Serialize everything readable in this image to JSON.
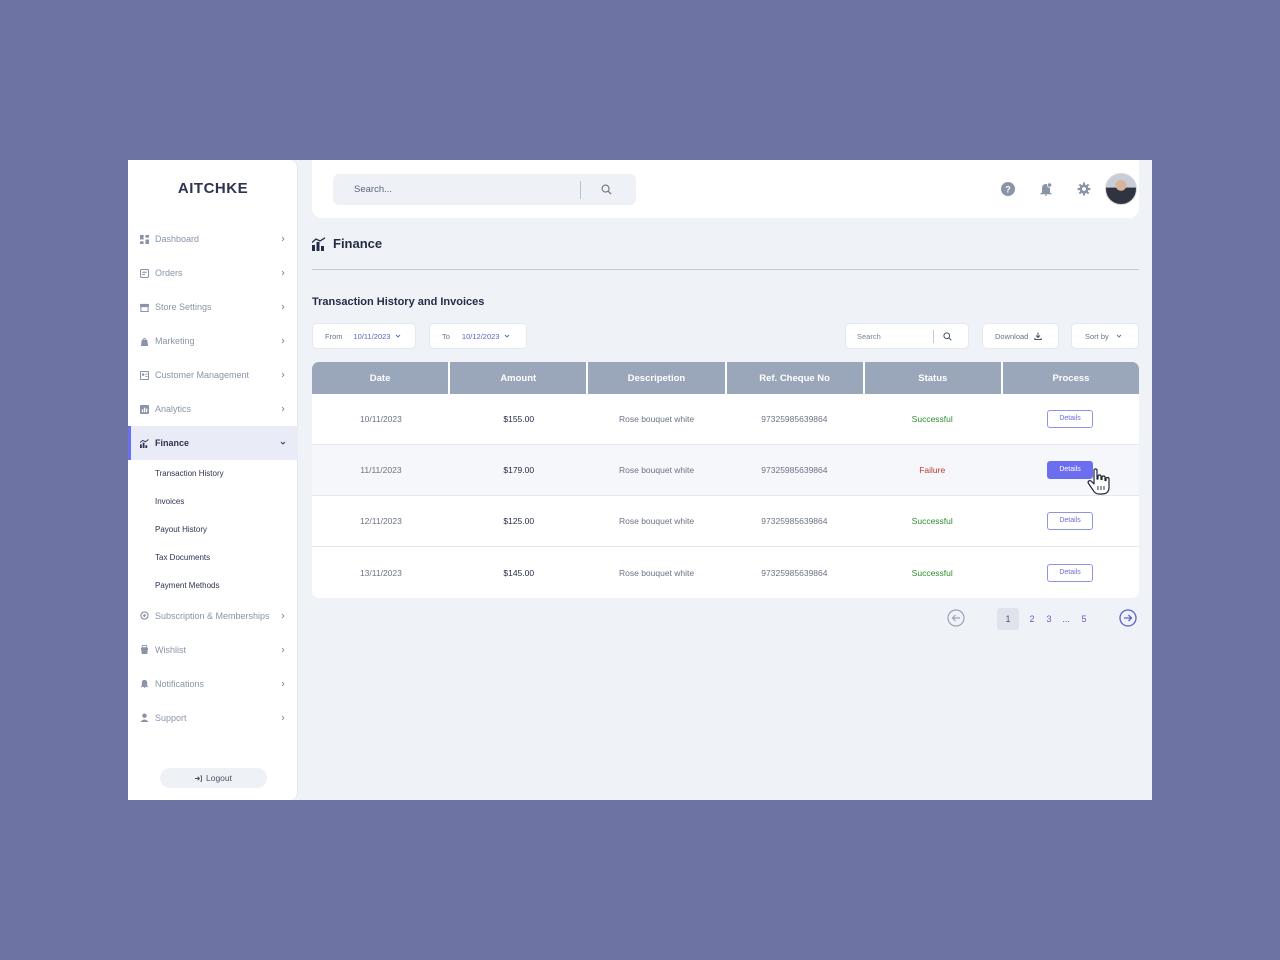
{
  "brand": "AITCHKE",
  "sidebar": {
    "items": [
      {
        "label": "Dashboard",
        "icon": "dashboard-icon"
      },
      {
        "label": "Orders",
        "icon": "orders-icon"
      },
      {
        "label": "Store Settings",
        "icon": "store-icon"
      },
      {
        "label": "Marketing",
        "icon": "marketing-icon"
      },
      {
        "label": "Customer Management",
        "icon": "customers-icon"
      },
      {
        "label": "Analytics",
        "icon": "analytics-icon"
      },
      {
        "label": "Finance",
        "icon": "finance-icon",
        "active": true
      },
      {
        "label": "Subscription & Memberships",
        "icon": "subscription-icon"
      },
      {
        "label": "Wishlist",
        "icon": "wishlist-icon"
      },
      {
        "label": "Notifications",
        "icon": "notifications-icon"
      },
      {
        "label": "Support",
        "icon": "support-icon"
      }
    ],
    "finance_sub": [
      "Transaction History",
      "Invoices",
      "Payout History",
      "Tax Documents",
      "Payment Methods"
    ],
    "logout": "Logout"
  },
  "topbar": {
    "search_placeholder": "Search...",
    "icons": [
      "help-icon",
      "bell-icon",
      "gear-icon"
    ]
  },
  "page": {
    "title": "Finance",
    "section_title": "Transaction History and Invoices"
  },
  "filters": {
    "from_label": "From",
    "from_value": "10/11/2023",
    "to_label": "To",
    "to_value": "10/12/2023",
    "search_placeholder": "Search",
    "download": "Download",
    "sort": "Sort by"
  },
  "table": {
    "headers": [
      "Date",
      "Amount",
      "Descripetion",
      "Ref. Cheque No",
      "Status",
      "Process"
    ],
    "rows": [
      {
        "date": "10/11/2023",
        "amount": "$155.00",
        "description": "Rose bouquet white",
        "ref": "97325985639864",
        "status": "Successful",
        "action": "Details"
      },
      {
        "date": "11/11/2023",
        "amount": "$179.00",
        "description": "Rose bouquet white",
        "ref": "97325985639864",
        "status": "Failure",
        "action": "Details"
      },
      {
        "date": "12/11/2023",
        "amount": "$125.00",
        "description": "Rose bouquet white",
        "ref": "97325985639864",
        "status": "Successful",
        "action": "Details"
      },
      {
        "date": "13/11/2023",
        "amount": "$145.00",
        "description": "Rose bouquet white",
        "ref": "97325985639864",
        "status": "Successful",
        "action": "Details"
      }
    ]
  },
  "pagination": {
    "pages": [
      "1",
      "2",
      "3",
      "...",
      "5"
    ],
    "current": "1"
  },
  "colors": {
    "accent": "#6b6eef",
    "success": "#2e8b2e",
    "failure": "#c0392b",
    "header_bg": "#9aa6ba"
  }
}
